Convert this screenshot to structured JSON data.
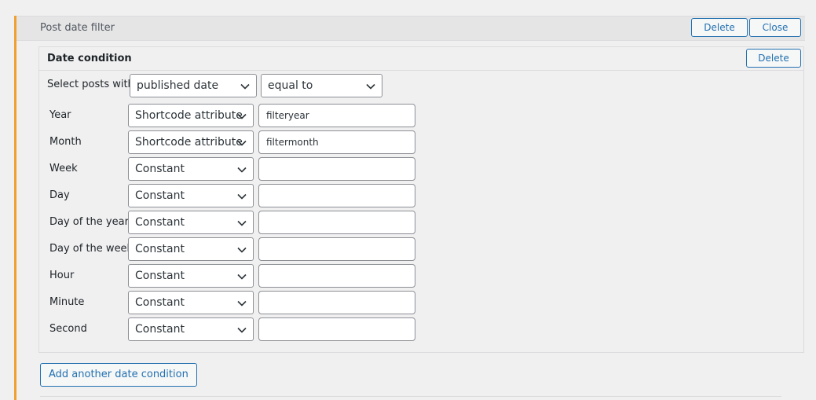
{
  "panel": {
    "title": "Post date filter",
    "delete_label": "Delete",
    "close_label": "Close"
  },
  "condition": {
    "title": "Date condition",
    "delete_label": "Delete",
    "select_posts_label": "Select posts with",
    "date_field": "published date",
    "comparison": "equal to",
    "rows": [
      {
        "label": "Year",
        "source": "Shortcode attribute",
        "value": "filteryear"
      },
      {
        "label": "Month",
        "source": "Shortcode attribute",
        "value": "filtermonth"
      },
      {
        "label": "Week",
        "source": "Constant",
        "value": ""
      },
      {
        "label": "Day",
        "source": "Constant",
        "value": ""
      },
      {
        "label": "Day of the year",
        "source": "Constant",
        "value": ""
      },
      {
        "label": "Day of the week",
        "source": "Constant",
        "value": ""
      },
      {
        "label": "Hour",
        "source": "Constant",
        "value": ""
      },
      {
        "label": "Minute",
        "source": "Constant",
        "value": ""
      },
      {
        "label": "Second",
        "source": "Constant",
        "value": ""
      }
    ]
  },
  "add_condition_label": "Add another date condition",
  "colors": {
    "accent": "#2271b1",
    "panel_border": "#f0a030",
    "background": "#f0f0f1"
  },
  "icons": {
    "dropdown": "chevron-down-icon"
  }
}
